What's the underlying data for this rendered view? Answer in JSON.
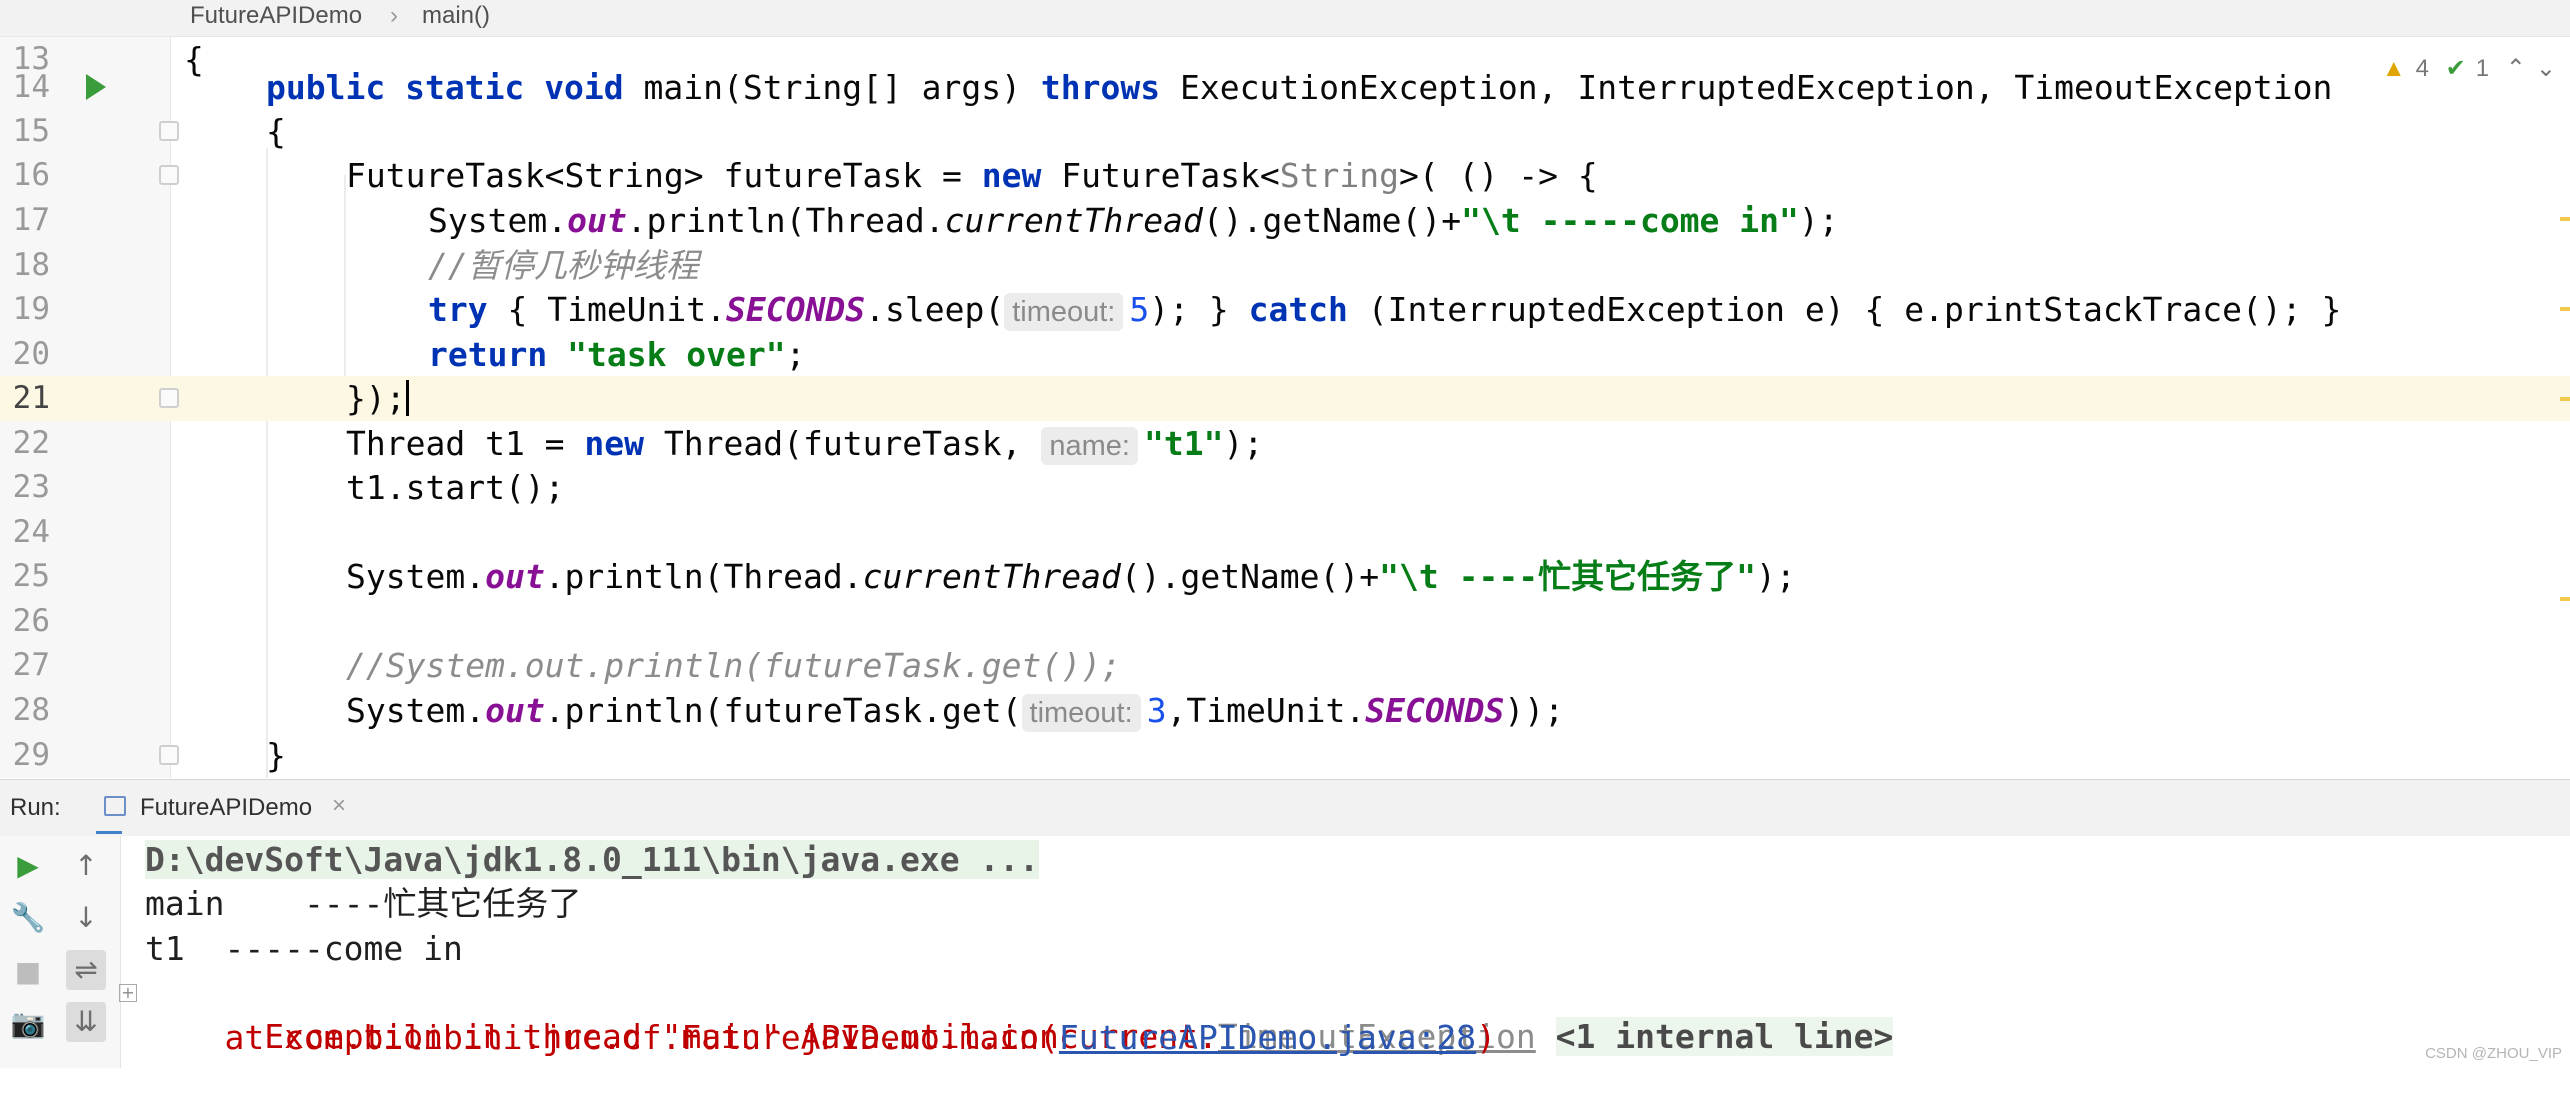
{
  "breadcrumb": {
    "file": "FutureAPIDemo",
    "separator": "›",
    "method": "main()"
  },
  "editor": {
    "inspections": {
      "warnings": "4",
      "weak_warnings": "1"
    },
    "lines": [
      {
        "num": "13"
      },
      {
        "num": "14"
      },
      {
        "num": "15"
      },
      {
        "num": "16"
      },
      {
        "num": "17"
      },
      {
        "num": "18"
      },
      {
        "num": "19"
      },
      {
        "num": "20"
      },
      {
        "num": "21"
      },
      {
        "num": "22"
      },
      {
        "num": "23"
      },
      {
        "num": "24"
      },
      {
        "num": "25"
      },
      {
        "num": "26"
      },
      {
        "num": "27"
      },
      {
        "num": "28"
      },
      {
        "num": "29"
      }
    ],
    "t": {
      "l13_brace": "{",
      "public": "public",
      "static": "static",
      "void": "void",
      "l14_sig": " main(String[] args) ",
      "throws": "throws",
      "l14_exc": " ExecutionException, InterruptedException, TimeoutException",
      "l15_brace": "{",
      "l16_a": "FutureTask<String> futureTask = ",
      "new": "new",
      "l16_b": " FutureTask<",
      "l16_generic": "String",
      "l16_c": ">( () -> {",
      "system": "System.",
      "out": "out",
      "l17_a": ".println(Thread.",
      "currentThread": "currentThread",
      "l17_b": "().getName()+",
      "l17_str": "\"\\t -----come in\"",
      "l17_end": ");",
      "l18_comment": "//暂停几秒钟线程",
      "try": "try",
      "l19_a": " { TimeUnit.",
      "SECONDS": "SECONDS",
      "l19_b": ".sleep(",
      "hint_timeout": "timeout:",
      "l19_num": "5",
      "l19_c": "); } ",
      "catch": "catch",
      "l19_d": " (InterruptedException e) { e.printStackTrace(); }",
      "return": "return",
      "l20_str": "\"task over\"",
      "semicolon": ";",
      "l21_text": "});",
      "l22_a": "Thread t1 = ",
      "l22_b": " Thread(futureTask, ",
      "hint_name": "name:",
      "l22_str": "\"t1\"",
      "l22_end": ");",
      "l23_text": "t1.start();",
      "l25_a": ".println(Thread.",
      "l25_b": "().getName()+",
      "l25_str": "\"\\t ----忙其它任务了\"",
      "l25_end": ");",
      "l27_comment": "//System.out.println(futureTask.get());",
      "l28_a": ".println(futureTask.get(",
      "l28_num": "3",
      "l28_b": ",TimeUnit.",
      "l28_end": "));",
      "l29_brace": "}"
    }
  },
  "run": {
    "label": "Run:",
    "tab_title": "FutureAPIDemo",
    "tab_close": "×",
    "toolbar": {
      "rerun": "▶",
      "up": "↑",
      "down": "↓",
      "wrench": "🔧",
      "soft_wrap": "⇌",
      "stop": "■",
      "scroll_end": "⇊",
      "camera": "📷"
    },
    "console": {
      "cmd": "D:\\devSoft\\Java\\jdk1.8.0_111\\bin\\java.exe ...",
      "out1": "main    ----忙其它任务了",
      "out2": "t1  -----come in",
      "expand": "+",
      "err_prefix": "Exception in thread \"main\" java.util.concurrent.",
      "err_exc": "TimeoutException",
      "err_internal": "<1 internal line>",
      "trace_prefix": "    at com.bilibili.juc.cf.FutureAPIDemo.main(",
      "trace_link": "FutureAPIDemo.java:28",
      "trace_end": ")"
    }
  },
  "watermark": "CSDN @ZHOU_VIP"
}
